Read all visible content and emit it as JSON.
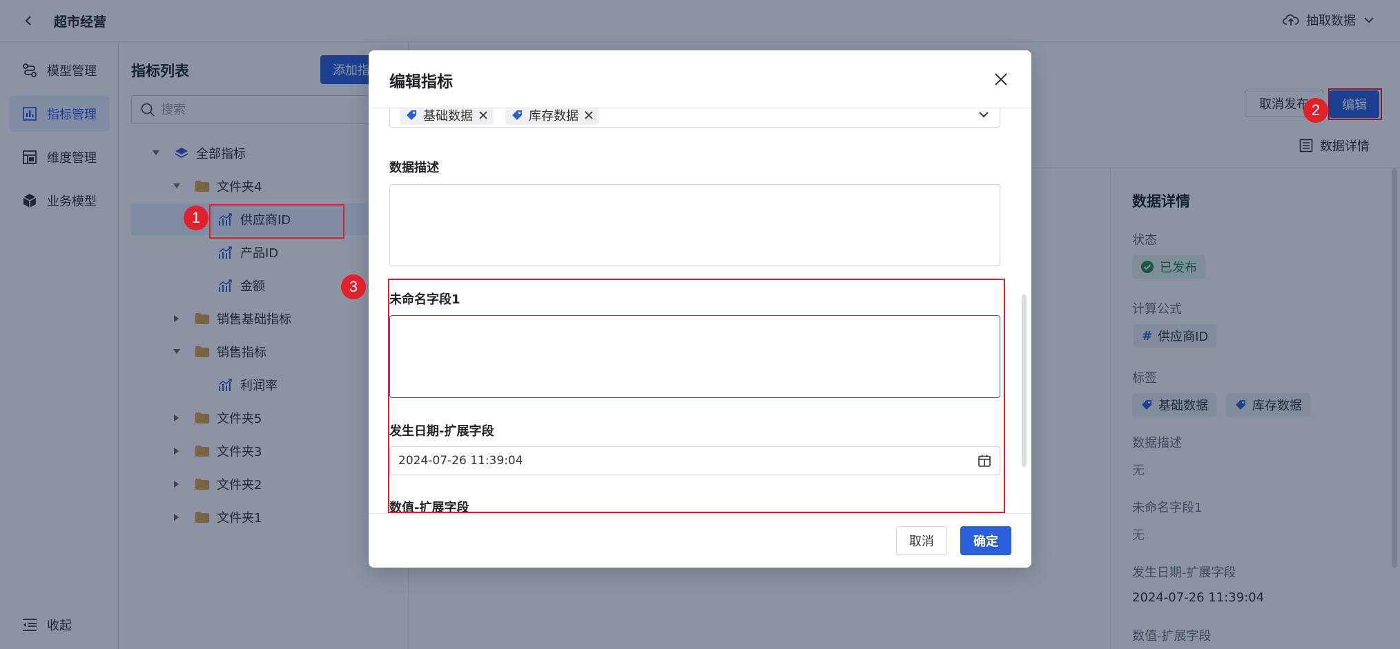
{
  "app": {
    "title": "超市经营",
    "extract_label": "抽取数据"
  },
  "nav": {
    "items": [
      {
        "label": "模型管理",
        "icon": "model-icon"
      },
      {
        "label": "指标管理",
        "icon": "chart-icon",
        "active": true
      },
      {
        "label": "维度管理",
        "icon": "dimension-icon"
      },
      {
        "label": "业务模型",
        "icon": "cube-icon"
      }
    ],
    "collapse_label": "收起"
  },
  "tree": {
    "title": "指标列表",
    "add_label": "添加指标",
    "search_placeholder": "搜索",
    "rows": [
      {
        "label": "全部指标"
      },
      {
        "label": "文件夹4"
      },
      {
        "label": "供应商ID"
      },
      {
        "label": "产品ID"
      },
      {
        "label": "金额"
      },
      {
        "label": "销售基础指标"
      },
      {
        "label": "销售指标"
      },
      {
        "label": "利润率"
      },
      {
        "label": "文件夹5"
      },
      {
        "label": "文件夹3"
      },
      {
        "label": "文件夹2"
      },
      {
        "label": "文件夹1"
      }
    ]
  },
  "main": {
    "unpublish_label": "取消发布",
    "edit_label": "编辑",
    "detail_link": "数据详情"
  },
  "details": {
    "title": "数据详情",
    "status_label": "状态",
    "status_value": "已发布",
    "formula_label": "计算公式",
    "formula_value": "供应商ID",
    "tags_label": "标签",
    "tags": [
      "基础数据",
      "库存数据"
    ],
    "desc_label": "数据描述",
    "desc_value": "无",
    "field1_label": "未命名字段1",
    "field1_value": "无",
    "date_label": "发生日期-扩展字段",
    "date_value": "2024-07-26 11:39:04",
    "num_label": "数值-扩展字段"
  },
  "dialog": {
    "title": "编辑指标",
    "tags": [
      "基础数据",
      "库存数据"
    ],
    "desc_label": "数据描述",
    "field1_label": "未命名字段1",
    "date_label": "发生日期-扩展字段",
    "date_value": "2024-07-26 11:39:04",
    "num_label": "数值-扩展字段",
    "cancel_label": "取消",
    "ok_label": "确定"
  },
  "annotations": [
    "1",
    "2",
    "3"
  ],
  "colors": {
    "primary": "#2b5fd9",
    "annotation": "#e0202a",
    "success": "#1f8a45"
  }
}
